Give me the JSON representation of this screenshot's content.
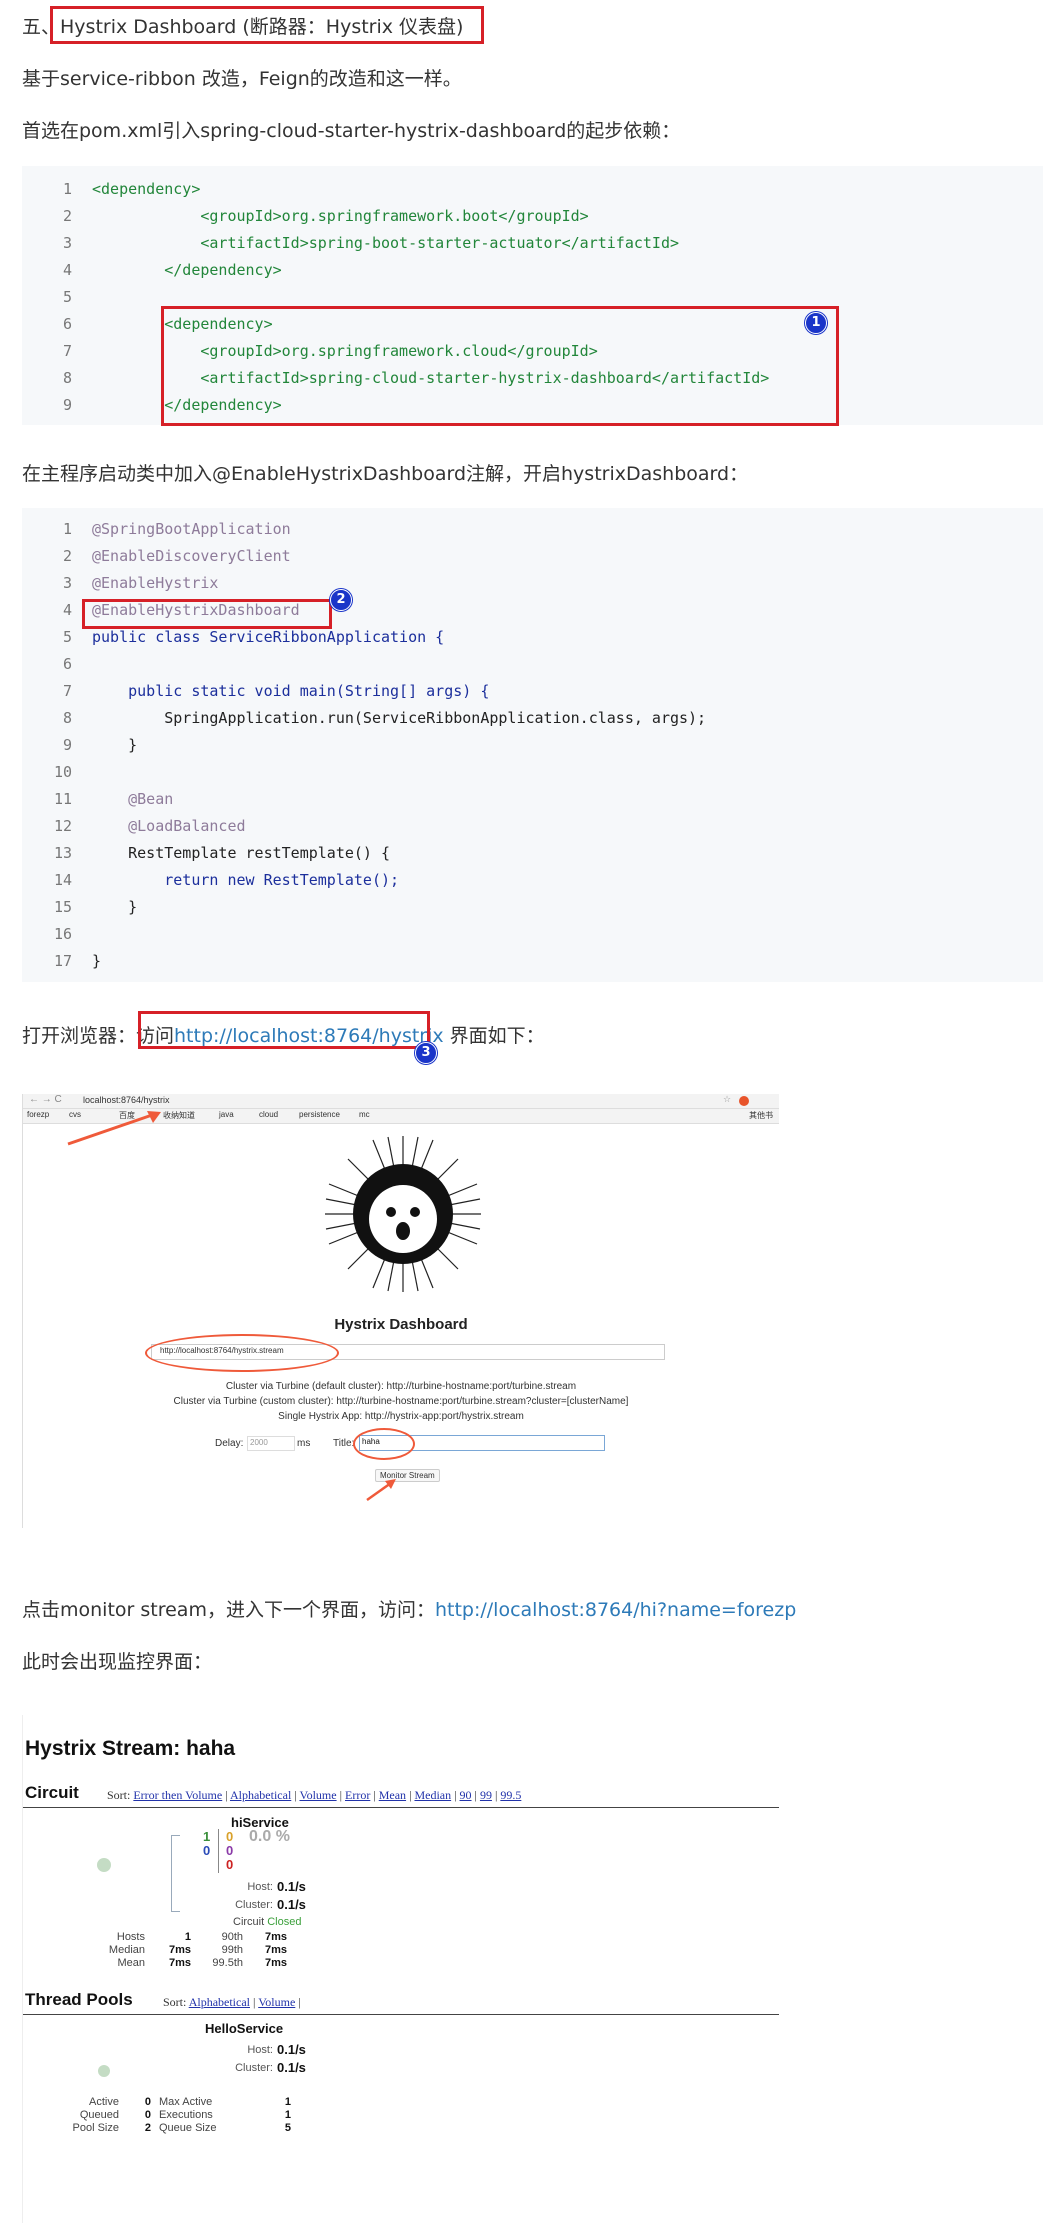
{
  "section": {
    "prefix": "五、",
    "title": "Hystrix Dashboard (断路器：Hystrix 仪表盘)"
  },
  "paragraphs": {
    "p1": "基于service-ribbon 改造，Feign的改造和这一样。",
    "p2": "首选在pom.xml引入spring-cloud-starter-hystrix-dashboard的起步依赖：",
    "p3": "在主程序启动类中加入@EnableHystrixDashboard注解，开启hystrixDashboard：",
    "p4_before": "打开浏览器：访问",
    "p4_link": "http://localhost:8764/hystrix",
    "p4_after": " 界面如下：",
    "p5_before": "点击monitor stream，进入下一个界面，访问：",
    "p5_link": "http://localhost:8764/hi?name=forezp",
    "p6": "此时会出现监控界面："
  },
  "code1": {
    "line_numbers": [
      "1",
      "2",
      "3",
      "4",
      "5",
      "6",
      "7",
      "8",
      "9"
    ],
    "lines": [
      "<dependency>",
      "            <groupId>org.springframework.boot</groupId>",
      "            <artifactId>spring-boot-starter-actuator</artifactId>",
      "        </dependency>",
      "",
      "        <dependency>",
      "            <groupId>org.springframework.cloud</groupId>",
      "            <artifactId>spring-cloud-starter-hystrix-dashboard</artifactId>",
      "        </dependency>"
    ]
  },
  "code2": {
    "line_numbers": [
      "1",
      "2",
      "3",
      "4",
      "5",
      "6",
      "7",
      "8",
      "9",
      "10",
      "11",
      "12",
      "13",
      "14",
      "15",
      "16",
      "17"
    ],
    "lines": [
      "@SpringBootApplication",
      "@EnableDiscoveryClient",
      "@EnableHystrix",
      "@EnableHystrixDashboard",
      "public class ServiceRibbonApplication {",
      "",
      "    public static void main(String[] args) {",
      "        SpringApplication.run(ServiceRibbonApplication.class, args);",
      "    }",
      "",
      "    @Bean",
      "    @LoadBalanced",
      "    RestTemplate restTemplate() {",
      "        return new RestTemplate();",
      "    }",
      "",
      "}"
    ]
  },
  "badges": [
    "1",
    "2",
    "3"
  ],
  "browser_shot": {
    "address": "localhost:8764/hystrix",
    "bookmarks": [
      "forezp",
      "cvs",
      "百度",
      "收纳知道",
      "java",
      "cloud",
      "persistence",
      "mc"
    ],
    "other_bookmarks": "其他书",
    "heading": "Hystrix Dashboard",
    "stream_input": "http://localhost:8764/hystrix.stream",
    "hint1": "Cluster via Turbine (default cluster): http://turbine-hostname:port/turbine.stream",
    "hint2": "Cluster via Turbine (custom cluster): http://turbine-hostname:port/turbine.stream?cluster=[clusterName]",
    "hint3": "Single Hystrix App: http://hystrix-app:port/hystrix.stream",
    "delay_label": "Delay:",
    "delay_value": "2000",
    "delay_unit": "ms",
    "title_label": "Title:",
    "title_value": "haha",
    "monitor_button": "Monitor Stream"
  },
  "stream_shot": {
    "title": "Hystrix Stream: haha",
    "circuit_heading": "Circuit",
    "sort_label": "Sort:",
    "circuit_sorts": [
      "Error then Volume",
      "Alphabetical",
      "Volume",
      "Error",
      "Mean",
      "Median",
      "90",
      "99",
      "99.5"
    ],
    "service_name": "hiService",
    "counts_green": "1",
    "counts_blue": "0",
    "counts_orange": "0",
    "counts_purple": "0",
    "counts_red": "0",
    "error_pct": "0.0 %",
    "host_label": "Host:",
    "host_value": "0.1/s",
    "cluster_label": "Cluster:",
    "cluster_value": "0.1/s",
    "circuit_label": "Circuit",
    "circuit_state": "Closed",
    "stats": [
      {
        "label": "Hosts",
        "value": "1",
        "plabel": "90th",
        "pvalue": "7ms"
      },
      {
        "label": "Median",
        "value": "7ms",
        "plabel": "99th",
        "pvalue": "7ms"
      },
      {
        "label": "Mean",
        "value": "7ms",
        "plabel": "99.5th",
        "pvalue": "7ms"
      }
    ],
    "pools_heading": "Thread Pools",
    "pool_sorts": [
      "Alphabetical",
      "Volume"
    ],
    "pool_name": "HelloService",
    "pool_host_value": "0.1/s",
    "pool_cluster_value": "0.1/s",
    "pool_stats": [
      {
        "label": "Active",
        "value": "0",
        "label2": "Max Active",
        "value2": "1"
      },
      {
        "label": "Queued",
        "value": "0",
        "label2": "Executions",
        "value2": "1"
      },
      {
        "label": "Pool Size",
        "value": "2",
        "label2": "Queue Size",
        "value2": "5"
      }
    ]
  }
}
